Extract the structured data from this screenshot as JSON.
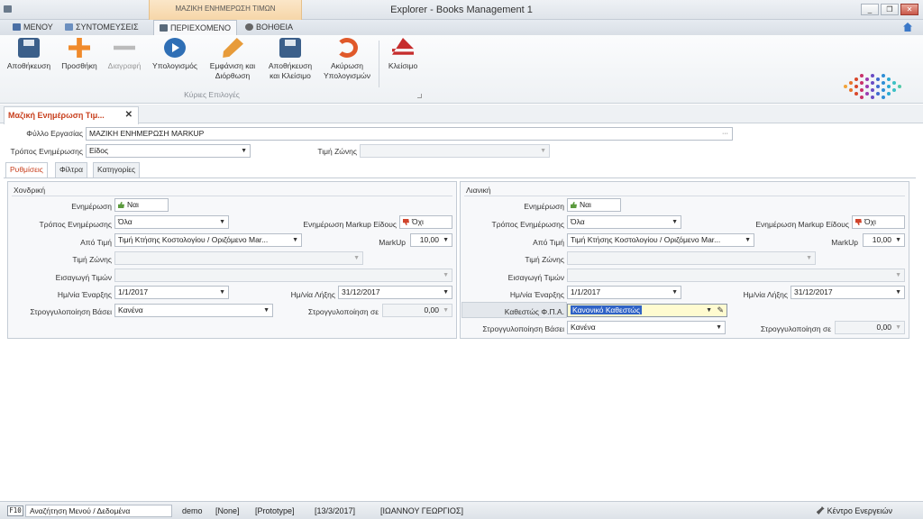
{
  "window": {
    "title": "Explorer - Books Management 1",
    "context_tab": "ΜΑΖΙΚΗ ΕΝΗΜΕΡΩΣΗ ΤΙΜΩΝ",
    "btn_minimize": "_",
    "btn_restore": "❐",
    "btn_close": "✕"
  },
  "menubar": {
    "tabs": [
      {
        "label": "ΜΕΝΟΥ"
      },
      {
        "label": "ΣΥΝΤΟΜΕΥΣΕΙΣ"
      },
      {
        "label": "ΠΕΡΙΕΧΟΜΕΝΟ"
      },
      {
        "label": "ΒΟΗΘΕΙΑ"
      }
    ]
  },
  "ribbon": {
    "save": "Αποθήκευση",
    "add": "Προσθήκη",
    "delete": "Διαγραφή",
    "calculate": "Υπολογισμός",
    "show_edit_1": "Εμφάνιση και",
    "show_edit_2": "Διόρθωση",
    "save_close_1": "Αποθήκευση",
    "save_close_2": "και Κλείσιμο",
    "cancel_calc_1": "Ακύρωση",
    "cancel_calc_2": "Υπολογισμών",
    "close": "Κλείσιμο",
    "group_label": "Κύριες Επιλογές"
  },
  "doc_tab": {
    "label": "Μαζική Ενημέρωση Τιμ...",
    "close": "✕"
  },
  "header": {
    "worksheet_label": "Φύλλο Εργασίας",
    "worksheet_value": "ΜΑΖΙΚΗ ΕΝΗΜΕΡΩΣΗ MARKUP",
    "worksheet_btn": "···",
    "update_mode_label": "Τρόπος Ενημέρωσης",
    "update_mode_value": "Είδος",
    "zone_price_label": "Τιμή Ζώνης",
    "zone_price_value": ""
  },
  "subtabs": [
    {
      "label": "Ρυθμίσεις"
    },
    {
      "label": "Φίλτρα"
    },
    {
      "label": "Κατηγορίες"
    }
  ],
  "wholesale": {
    "title": "Χονδρική",
    "update_label": "Ενημέρωση",
    "update_value": "Ναι",
    "mode_label": "Τρόπος Ενημέρωσης",
    "mode_value": "Όλα",
    "markup_item_label": "Ενημέρωση Markup Είδους",
    "markup_item_value": "Όχι",
    "from_price_label": "Από Τιμή",
    "from_price_value": "Τιμή Κτήσης Κοστολογίου / Οριζόμενο Mar...",
    "markup_label": "MarkUp",
    "markup_value": "10,00",
    "zone_label": "Τιμή Ζώνης",
    "zone_value": "",
    "import_label": "Εισαγωγή Τιμών",
    "import_value": "",
    "start_label": "Ημ/νία Έναρξης",
    "start_value": "1/1/2017",
    "end_label": "Ημ/νία Λήξης",
    "end_value": "31/12/2017",
    "round_label": "Στρογγυλοποίηση Βάσει",
    "round_value": "Κανένα",
    "round_to_label": "Στρογγυλοποίηση σε",
    "round_to_value": "0,00"
  },
  "retail": {
    "title": "Λιανική",
    "update_label": "Ενημέρωση",
    "update_value": "Ναι",
    "mode_label": "Τρόπος Ενημέρωσης",
    "mode_value": "Όλα",
    "markup_item_label": "Ενημέρωση Markup Είδους",
    "markup_item_value": "Όχι",
    "from_price_label": "Από Τιμή",
    "from_price_value": "Τιμή Κτήσης Κοστολογίου / Οριζόμενο Mar...",
    "markup_label": "MarkUp",
    "markup_value": "10,00",
    "zone_label": "Τιμή Ζώνης",
    "zone_value": "",
    "import_label": "Εισαγωγή Τιμών",
    "import_value": "",
    "start_label": "Ημ/νία Έναρξης",
    "start_value": "1/1/2017",
    "end_label": "Ημ/νία Λήξης",
    "end_value": "31/12/2017",
    "vat_label": "Καθεστώς Φ.Π.Α.",
    "vat_value": "Κανονικό Καθεστώς",
    "round_label": "Στρογγυλοποίηση Βάσει",
    "round_value": "Κανένα",
    "round_to_label": "Στρογγυλοποίηση σε",
    "round_to_value": "0,00"
  },
  "statusbar": {
    "key": "F10",
    "search": "Αναζήτηση Μενού / Δεδομένα",
    "user": "demo",
    "none": "[None]",
    "mode": "[Prototype]",
    "date": "[13/3/2017]",
    "name": "[ΙΩΑΝΝΟΥ ΓΕΩΡΓΙΟΣ]",
    "activity_center": "Κέντρο Ενεργειών"
  }
}
